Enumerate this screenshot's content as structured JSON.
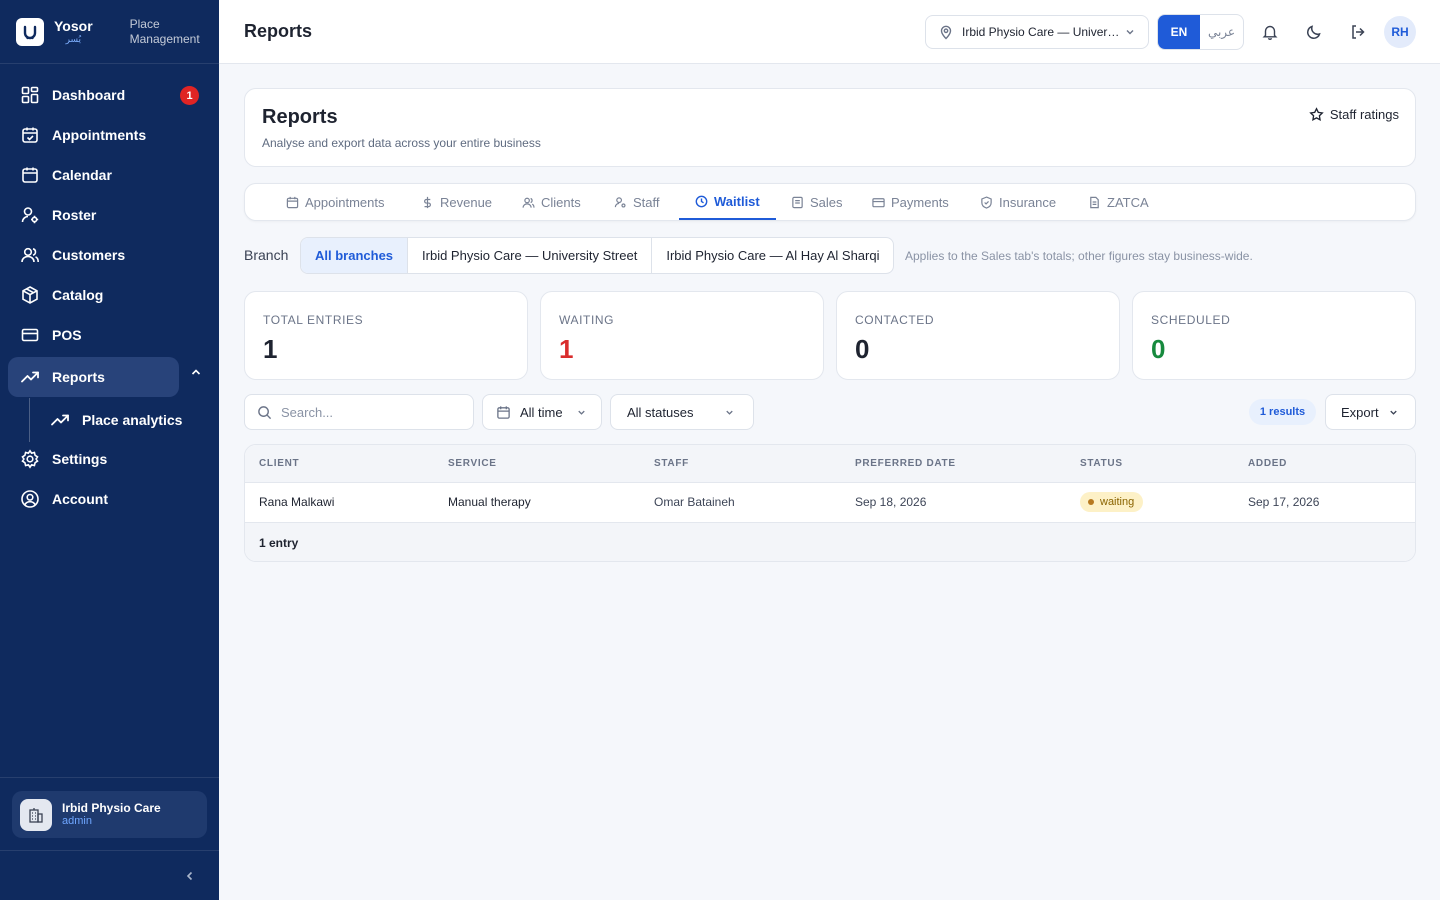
{
  "brand": {
    "name": "Yosor",
    "name_ar": "يُسر",
    "subtitle": "Place Management",
    "logo_icon": "yosor-logo-icon"
  },
  "sidebar": {
    "items": [
      {
        "label": "Dashboard",
        "icon": "dashboard-grid-icon",
        "badge": "1"
      },
      {
        "label": "Appointments",
        "icon": "calendar-check-icon"
      },
      {
        "label": "Calendar",
        "icon": "calendar-icon"
      },
      {
        "label": "Roster",
        "icon": "user-gear-icon"
      },
      {
        "label": "Customers",
        "icon": "users-icon"
      },
      {
        "label": "Catalog",
        "icon": "box-icon"
      },
      {
        "label": "POS",
        "icon": "credit-card-icon"
      },
      {
        "label": "Reports",
        "icon": "trending-up-icon",
        "active": true,
        "expanded": true
      },
      {
        "label": "Place analytics",
        "icon": "trending-up-icon",
        "sub": true
      },
      {
        "label": "Settings",
        "icon": "gear-icon"
      },
      {
        "label": "Account",
        "icon": "user-circle-icon"
      }
    ],
    "org": {
      "name": "Irbid Physio Care",
      "role": "admin",
      "icon": "building-icon"
    },
    "collapse_icon": "chevron-left-icon"
  },
  "topbar": {
    "title": "Reports",
    "branch_select": "Irbid Physio Care — University Street",
    "lang_en": "EN",
    "lang_ar": "عربي",
    "avatar_initials": "RH"
  },
  "header": {
    "title": "Reports",
    "subtitle": "Analyse and export data across your entire business",
    "staff_ratings": "Staff ratings"
  },
  "tabs": [
    {
      "label": "Appointments",
      "icon": "calendar-icon"
    },
    {
      "label": "Revenue",
      "icon": "dollar-icon"
    },
    {
      "label": "Clients",
      "icon": "users-icon"
    },
    {
      "label": "Staff",
      "icon": "user-gear-icon"
    },
    {
      "label": "Waitlist",
      "icon": "clock-icon",
      "active": true
    },
    {
      "label": "Sales",
      "icon": "receipt-icon"
    },
    {
      "label": "Payments",
      "icon": "credit-card-icon"
    },
    {
      "label": "Insurance",
      "icon": "shield-check-icon"
    },
    {
      "label": "ZATCA",
      "icon": "document-icon"
    }
  ],
  "branch_filter": {
    "label": "Branch",
    "options": [
      "All branches",
      "Irbid Physio Care — University Street",
      "Irbid Physio Care — Al Hay Al Sharqi"
    ],
    "selected": "All branches",
    "note": "Applies to the Sales tab's totals; other figures stay business-wide."
  },
  "stats": [
    {
      "label": "TOTAL ENTRIES",
      "value": "1",
      "color": "#1e2330"
    },
    {
      "label": "WAITING",
      "value": "1",
      "color": "#d92d2d"
    },
    {
      "label": "CONTACTED",
      "value": "0",
      "color": "#1e2330"
    },
    {
      "label": "SCHEDULED",
      "value": "0",
      "color": "#178a3e"
    }
  ],
  "toolbar": {
    "search_placeholder": "Search...",
    "date_filter": "All time",
    "status_filter": "All statuses",
    "results": "1 results",
    "export": "Export"
  },
  "table": {
    "columns": [
      "CLIENT",
      "SERVICE",
      "STAFF",
      "PREFERRED DATE",
      "STATUS",
      "ADDED"
    ],
    "rows": [
      {
        "client": "Rana Malkawi",
        "service": "Manual therapy",
        "staff": "Omar Bataineh",
        "preferred_date": "Sep 18, 2026",
        "status": "waiting",
        "added": "Sep 17, 2026"
      }
    ],
    "footer": "1 entry"
  },
  "colors": {
    "sidebar_bg": "#0f2a5e",
    "accent": "#1f5bd8",
    "danger": "#d92d2d",
    "success": "#178a3e",
    "badge": "#e02424"
  }
}
